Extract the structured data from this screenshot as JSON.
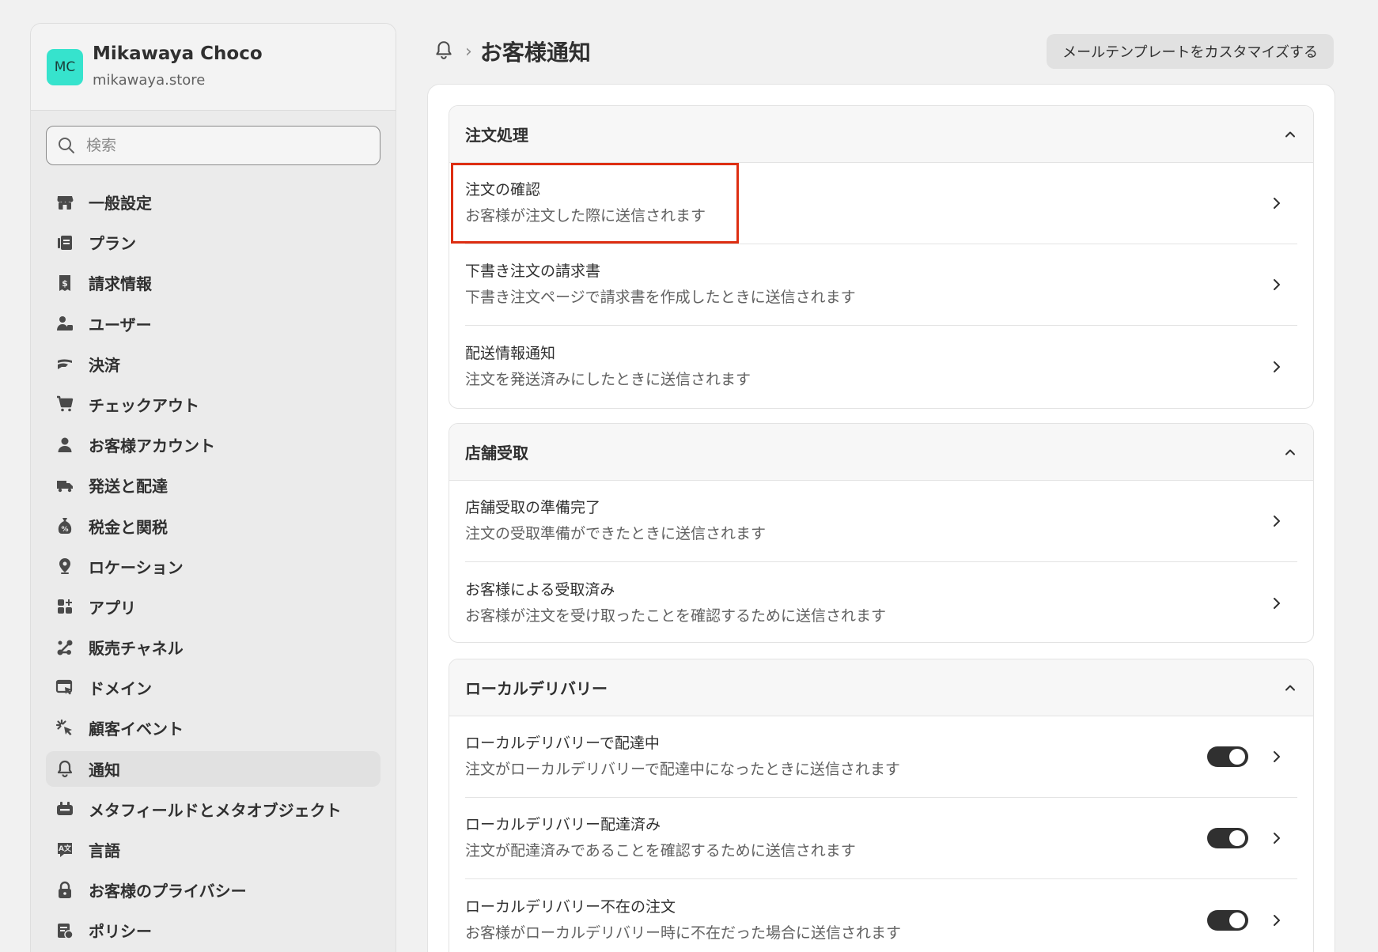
{
  "store": {
    "initials": "MC",
    "name": "Mikawaya Choco",
    "domain": "mikawaya.store",
    "avatar_color": "#36e3cd"
  },
  "search": {
    "placeholder": "検索",
    "value": ""
  },
  "sidebar": {
    "items": [
      {
        "label": "一般設定",
        "icon": "store-icon"
      },
      {
        "label": "プラン",
        "icon": "plan-icon"
      },
      {
        "label": "請求情報",
        "icon": "billing-icon"
      },
      {
        "label": "ユーザー",
        "icon": "users-icon"
      },
      {
        "label": "決済",
        "icon": "payments-icon"
      },
      {
        "label": "チェックアウト",
        "icon": "cart-icon"
      },
      {
        "label": "お客様アカウント",
        "icon": "person-icon"
      },
      {
        "label": "発送と配達",
        "icon": "truck-icon"
      },
      {
        "label": "税金と関税",
        "icon": "tax-icon"
      },
      {
        "label": "ロケーション",
        "icon": "location-icon"
      },
      {
        "label": "アプリ",
        "icon": "apps-icon"
      },
      {
        "label": "販売チャネル",
        "icon": "channels-icon"
      },
      {
        "label": "ドメイン",
        "icon": "domain-icon"
      },
      {
        "label": "顧客イベント",
        "icon": "customer-events-icon"
      },
      {
        "label": "通知",
        "icon": "bell-icon",
        "active": true
      },
      {
        "label": "メタフィールドとメタオブジェクト",
        "icon": "metafields-icon"
      },
      {
        "label": "言語",
        "icon": "language-icon"
      },
      {
        "label": "お客様のプライバシー",
        "icon": "lock-icon"
      },
      {
        "label": "ポリシー",
        "icon": "policy-icon"
      }
    ]
  },
  "header": {
    "icon": "bell-icon",
    "title": "お客様通知",
    "customize_button": "メールテンプレートをカスタマイズする"
  },
  "sections": [
    {
      "title": "注文処理",
      "rows": [
        {
          "title": "注文の確認",
          "desc": "お客様が注文した際に送信されます",
          "highlighted": true
        },
        {
          "title": "下書き注文の請求書",
          "desc": "下書き注文ページで請求書を作成したときに送信されます"
        },
        {
          "title": "配送情報通知",
          "desc": "注文を発送済みにしたときに送信されます"
        }
      ]
    },
    {
      "title": "店舗受取",
      "rows": [
        {
          "title": "店舗受取の準備完了",
          "desc": "注文の受取準備ができたときに送信されます"
        },
        {
          "title": "お客様による受取済み",
          "desc": "お客様が注文を受け取ったことを確認するために送信されます"
        }
      ]
    },
    {
      "title": "ローカルデリバリー",
      "rows": [
        {
          "title": "ローカルデリバリーで配達中",
          "desc": "注文がローカルデリバリーで配達中になったときに送信されます",
          "toggle": true
        },
        {
          "title": "ローカルデリバリー配達済み",
          "desc": "注文が配達済みであることを確認するために送信されます",
          "toggle": true
        },
        {
          "title": "ローカルデリバリー不在の注文",
          "desc": "お客様がローカルデリバリー時に不在だった場合に送信されます",
          "toggle": true
        }
      ]
    }
  ],
  "colors": {
    "highlight": "#dd2e12",
    "toggle_on": "#303030",
    "background": "#f1f1f1"
  }
}
